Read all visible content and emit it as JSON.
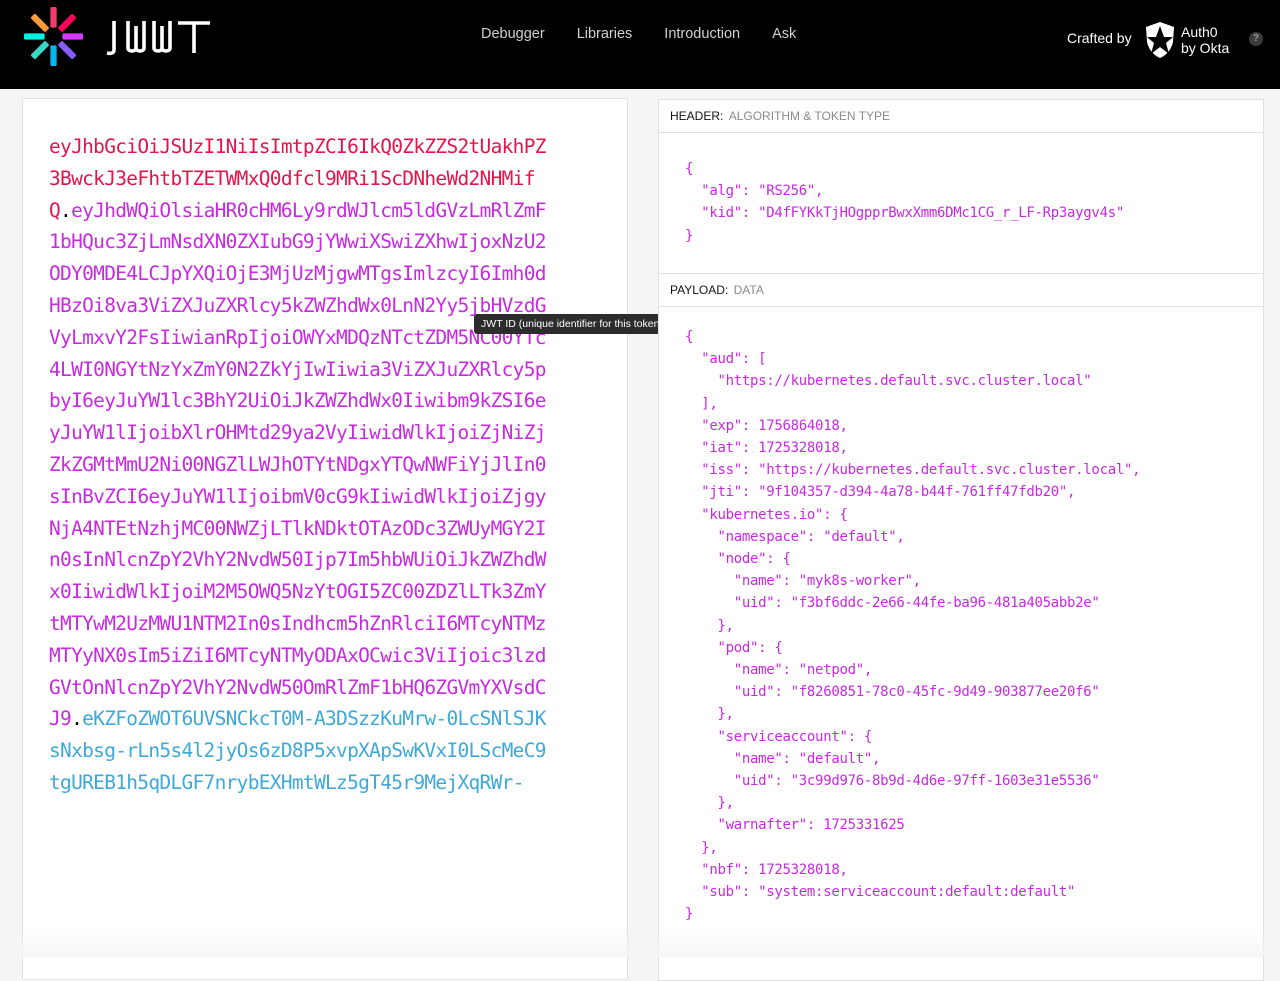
{
  "brand": {
    "name": "JWT",
    "logo_colors": [
      "#f83a6a",
      "#fb015b",
      "#d63aff",
      "#8a5cff",
      "#00b9f1",
      "#3ad7c4",
      "#00f2e6",
      "#ff9a3a"
    ]
  },
  "nav": {
    "items": [
      {
        "label": "Debugger"
      },
      {
        "label": "Libraries"
      },
      {
        "label": "Introduction"
      },
      {
        "label": "Ask"
      }
    ]
  },
  "crafted_by": {
    "label": "Crafted by",
    "company_line1": "Auth0",
    "company_line2": "by Okta",
    "help_icon": "?"
  },
  "encoded": {
    "header": "eyJhbGciOiJSUzI1NiIsImtpZCI6IkQ0ZkZZS2tUakhPZ3BwckJ3eFhtbTZETWMxQ0dfcl9MRi1ScDNheWd2NHMifQ",
    "dot1": ".",
    "payload": "eyJhdWQiOlsiaHR0cHM6Ly9rdWJlcm5ldGVzLmRlZmF1bHQuc3ZjLmNsdXN0ZXIubG9jYWwiXSwiZXhwIjoxNzU2ODY0MDE4LCJpYXQiOjE3MjUzMjgwMTgsImlzcyI6Imh0dHBzOi8va3ViZXJuZXRlcy5kZWZhdWx0LnN2Yy5jbHVzdGVyLmxvY2FsIiwianRpIjoiOWYxMDQzNTctZDM5NC00YTc4LWI0NGYtNzYxZmY0N2ZkYjIwIiwia3ViZXJuZXRlcy5pbyI6eyJuYW1lc3BhY2UiOiJkZWZhdWx0Iiwibm9kZSI6eyJuYW1lIjoibXlrOHMtd29ya2VyIiwidWlkIjoiZjNiZjZkZGMtMmU2Ni00NGZlLWJhOTYtNDgxYTQwNWFiYjJlIn0sInBvZCI6eyJuYW1lIjoibmV0cG9kIiwidWlkIjoiZjgyNjA4NTEtNzhjMC00NWZjLTlkNDktOTAzODc3ZWUyMGY2In0sInNlcnZpY2VhY2NvdW50Ijp7Im5hbWUiOiJkZWZhdWx0IiwidWlkIjoiM2M5OWQ5NzYtOGI5ZC00ZDZlLTk3ZmYtMTYwM2UzMWU1NTM2In0sIndhcm5hZnRlciI6MTcyNTMzMTYyNX0sIm5iZiI6MTcyNTMyODAxOCwic3ViIjoic3lzdGVtOnNlcnZpY2VhY2NvdW50OmRlZmF1bHQ6ZGVmYXVsdCJ9",
    "dot2": ".",
    "signature": "eKZFoZWOT6UVSNCkcT0M-A3DSzzKuMrw-0LcSNlSJKsNxbsg-rLn5s4l2jyOs6zD8P5xvpXApSwKVxI0LScMeC9tgUREB1h5qDLGF7nrybEXHmtWLz5gT45r9MejXqRWr-",
    "colors": {
      "header": "#e0164b",
      "payload": "#c72ae0",
      "signature": "#3ea8d9"
    }
  },
  "tooltip": {
    "text": "JWT ID (unique identifier for this token)"
  },
  "decoded": {
    "header_section": {
      "label": "HEADER:",
      "sub": "ALGORITHM & TOKEN TYPE",
      "json": "{\n  \"alg\": \"RS256\",\n  \"kid\": \"D4fFYKkTjHOgpprBwxXmm6DMc1CG_r_LF-Rp3aygv4s\"\n}"
    },
    "payload_section": {
      "label": "PAYLOAD:",
      "sub": "DATA",
      "json": "{\n  \"aud\": [\n    \"https://kubernetes.default.svc.cluster.local\"\n  ],\n  \"exp\": 1756864018,\n  \"iat\": 1725328018,\n  \"iss\": \"https://kubernetes.default.svc.cluster.local\",\n  \"jti\": \"9f104357-d394-4a78-b44f-761ff47fdb20\",\n  \"kubernetes.io\": {\n    \"namespace\": \"default\",\n    \"node\": {\n      \"name\": \"myk8s-worker\",\n      \"uid\": \"f3bf6ddc-2e66-44fe-ba96-481a405abb2e\"\n    },\n    \"pod\": {\n      \"name\": \"netpod\",\n      \"uid\": \"f8260851-78c0-45fc-9d49-903877ee20f6\"\n    },\n    \"serviceaccount\": {\n      \"name\": \"default\",\n      \"uid\": \"3c99d976-8b9d-4d6e-97ff-1603e31e5536\"\n    },\n    \"warnafter\": 1725331625\n  },\n  \"nbf\": 1725328018,\n  \"sub\": \"system:serviceaccount:default:default\"\n}"
    }
  }
}
